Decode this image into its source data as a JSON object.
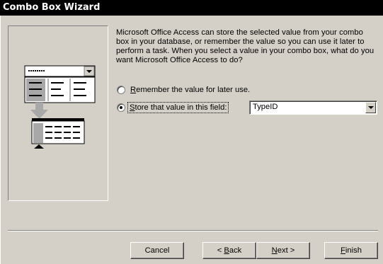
{
  "window": {
    "title": "Combo Box Wizard"
  },
  "illustration": {
    "name": "combo-box-illustration"
  },
  "description": "Microsoft Office Access can store the selected value from your combo box in your database, or remember the value so you can use it later to perform a task.  When you select a value in your combo box, what do you want Microsoft Office Access to do?",
  "options": {
    "remember": {
      "prefix": "",
      "hotkey": "R",
      "rest": "emember the value for later use.",
      "checked": false
    },
    "store": {
      "prefix": "",
      "hotkey": "S",
      "rest": "tore that value in this field:",
      "checked": true
    }
  },
  "field_combo": {
    "value": "TypeID"
  },
  "buttons": {
    "cancel": {
      "label": "Cancel"
    },
    "back": {
      "prefix": "< ",
      "hotkey": "B",
      "rest": "ack"
    },
    "next": {
      "prefix": "",
      "hotkey": "N",
      "rest": "ext >"
    },
    "finish": {
      "prefix": "",
      "hotkey": "F",
      "rest": "inish"
    }
  }
}
